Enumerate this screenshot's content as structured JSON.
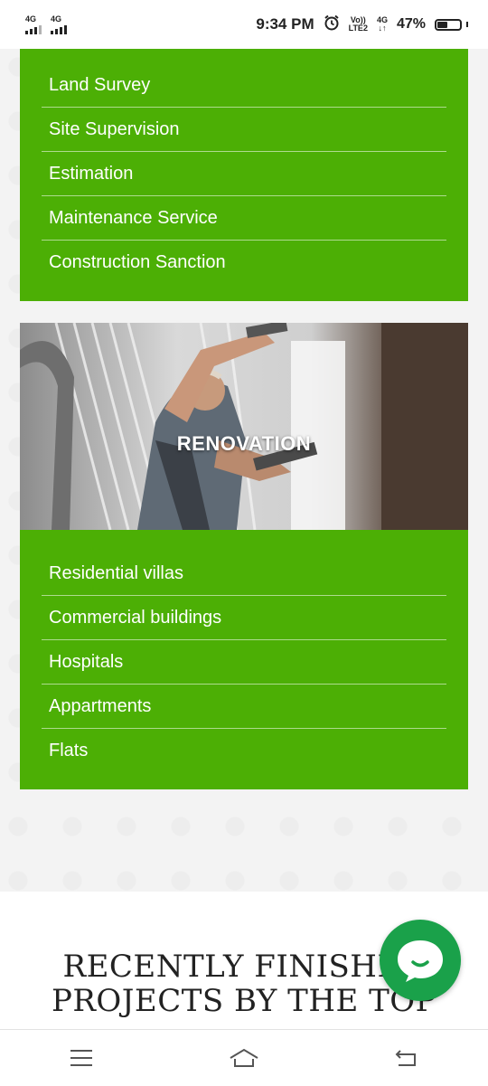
{
  "status_bar": {
    "sim1": "4G",
    "sim2": "4G",
    "time": "9:34 PM",
    "volte_top": "Vo))",
    "volte_bottom": "LTE2",
    "net_top": "4G",
    "net_bottom": "↓↑",
    "battery_percent": "47%",
    "battery_level": 0.47,
    "icons": [
      "signal-icon",
      "signal-icon",
      "alarm-icon",
      "battery-icon"
    ]
  },
  "services_menu": {
    "items": [
      {
        "label": "Land Survey"
      },
      {
        "label": "Site Supervision"
      },
      {
        "label": "Estimation"
      },
      {
        "label": "Maintenance Service"
      },
      {
        "label": "Construction Sanction"
      }
    ]
  },
  "renovation": {
    "title": "RENOVATION",
    "items": [
      {
        "label": "Residential villas"
      },
      {
        "label": "Commercial buildings"
      },
      {
        "label": "Hospitals"
      },
      {
        "label": "Appartments"
      },
      {
        "label": "Flats"
      }
    ]
  },
  "projects_section": {
    "heading_line1": "RECENTLY FINISHED",
    "heading_line2": "PROJECTS BY THE TOP"
  },
  "chat_button": {
    "icon": "chat-icon"
  },
  "colors": {
    "accent_green": "#4caf05",
    "chat_green": "#1aa14a"
  },
  "nav_bar": {
    "buttons": [
      "menu-icon",
      "home-icon",
      "back-icon"
    ]
  }
}
